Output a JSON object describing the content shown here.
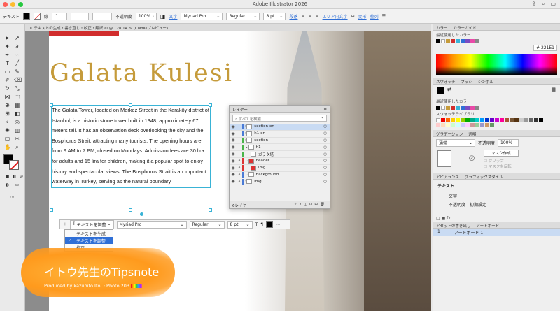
{
  "window": {
    "title": "Adobe Illustrator 2026"
  },
  "control_bar": {
    "object_type": "テキスト",
    "stroke_label": "線",
    "opacity_label": "不透明度",
    "opacity_value": "100%",
    "char_label": "文字",
    "font": "Myriad Pro",
    "style": "Regular",
    "size": "8 pt",
    "paragraph_label": "段落",
    "area_label": "エリア内文字",
    "transform_label": "変形",
    "align_label": "整列"
  },
  "document_tab": {
    "label": "テキストの生成・書き直し・校正・翻訳.ai @ 128.14 % (CMYK/プレビュー)"
  },
  "artboard": {
    "headline": "Galata Kulesi",
    "body": "The Galata Tower, located on Merkez Street in the Karaköy district of Istanbul, is a historic stone tower built in 1348, approximately 67 meters tall. It has an observation deck overlooking the city and the Bosphorus Strait, attracting many tourists. The opening hours are from 9 AM to 7 PM, closed on Mondays. Admission fees are 30 lira for adults and 15 lira for children, making it a popular spot to enjoy history and spectacular views. The Bosphorus Strait is an important waterway in Turkey, serving as the natural boundary"
  },
  "context_bar": {
    "adjust_label": "テキストを調整",
    "font": "Myriad Pro",
    "style": "Regular",
    "size": "8 pt"
  },
  "context_menu": {
    "items": [
      {
        "label": "テキストを生成",
        "active": false
      },
      {
        "label": "テキストを調整",
        "active": true
      },
      {
        "label": "校正",
        "active": false
      }
    ]
  },
  "layers_panel": {
    "title": "レイヤー",
    "search_placeholder": "すべてを検索",
    "rows": [
      {
        "name": "section-en",
        "color": "#4a7bd6",
        "selected": true
      },
      {
        "name": "h1-en",
        "color": "#4a7bd6",
        "selected": false
      },
      {
        "name": "section",
        "color": "#4ab44a",
        "selected": false
      },
      {
        "name": "h1",
        "color": "#4ab44a",
        "selected": false
      },
      {
        "name": "ガラタ塔",
        "color": "#4ab44a",
        "selected": false
      },
      {
        "name": "header",
        "color": "#d33",
        "selected": false
      },
      {
        "name": "img",
        "color": "#d33",
        "selected": false
      },
      {
        "name": "background",
        "color": "#4a7bd6",
        "selected": false
      },
      {
        "name": "img",
        "color": "#4a7bd6",
        "selected": false
      }
    ],
    "footer_count": "6レイヤー"
  },
  "right_panel": {
    "color_tabs": [
      "カラー",
      "カラーガイド"
    ],
    "recent_colors_label": "最近使用したカラー",
    "hex_value": "221E1",
    "swatch_tabs": [
      "スウォッチ",
      "ブラシ",
      "シンボル"
    ],
    "swatch_library_label": "スウォッチライブラリ",
    "gradient_tabs": [
      "グラデーション",
      "透明"
    ],
    "blend_mode": "通常",
    "opacity_label": "不透明度",
    "opacity_value": "100%",
    "mask_button": "マスク作成",
    "clip_label": "クリップ",
    "invert_label": "マスクを反転",
    "appearance_tabs": [
      "アピアランス",
      "グラフィックスタイル"
    ],
    "appearance_object": "テキスト",
    "appearance_char": "文字",
    "appearance_opacity": "不透明度",
    "appearance_opacity_value": "初期設定",
    "artboard_tabs": [
      "アセットの書き出し",
      "アートボード"
    ],
    "artboard_row_num": "1",
    "artboard_row_name": "アートボード 1"
  },
  "logo": {
    "title": "イトウ先生のTipsnote",
    "subtitle": "Produced by kazuhito Ito ・Photo 203"
  },
  "colors": {
    "accent": "#39b3d6",
    "headline": "#c59b3b",
    "selection": "#2f6fd6"
  }
}
